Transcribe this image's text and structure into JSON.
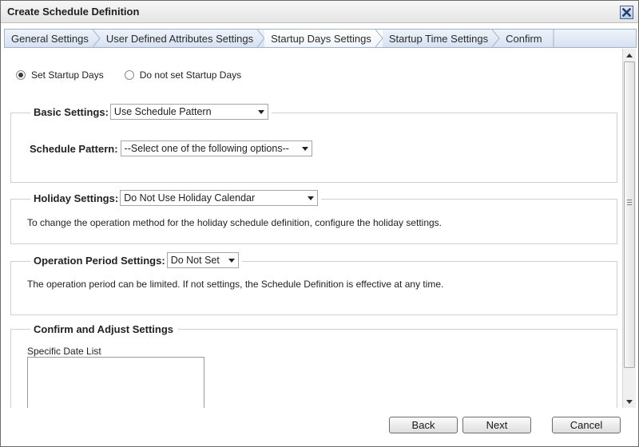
{
  "window": {
    "title": "Create Schedule Definition",
    "close_icon": "close-icon"
  },
  "tabs": [
    {
      "label": "General Settings",
      "active": false
    },
    {
      "label": "User Defined Attributes Settings",
      "active": false
    },
    {
      "label": "Startup Days Settings",
      "active": true
    },
    {
      "label": "Startup Time Settings",
      "active": false
    },
    {
      "label": "Confirm",
      "active": false
    }
  ],
  "startup_mode": {
    "options": [
      {
        "label": "Set Startup Days",
        "checked": true
      },
      {
        "label": "Do not set Startup Days",
        "checked": false
      }
    ]
  },
  "basic_settings": {
    "label": "Basic Settings:",
    "select_value": "Use Schedule Pattern",
    "schedule_pattern_label": "Schedule Pattern:",
    "schedule_pattern_value": "--Select one of the following options--"
  },
  "holiday_settings": {
    "label": "Holiday Settings:",
    "select_value": "Do Not Use Holiday Calendar",
    "description": "To change the operation method for the holiday schedule definition, configure the holiday settings."
  },
  "operation_period": {
    "label": "Operation Period Settings:",
    "select_value": "Do Not Set",
    "description": "The operation period can be limited. If not settings, the Schedule Definition is effective at any time."
  },
  "confirm_adjust": {
    "label": "Confirm and Adjust Settings",
    "list_label": "Specific Date List"
  },
  "footer": {
    "back_label": "Back",
    "next_label": "Next",
    "cancel_label": "Cancel"
  },
  "colors": {
    "accent": "#4a6690",
    "tab_bar": "#d6e2f1"
  }
}
